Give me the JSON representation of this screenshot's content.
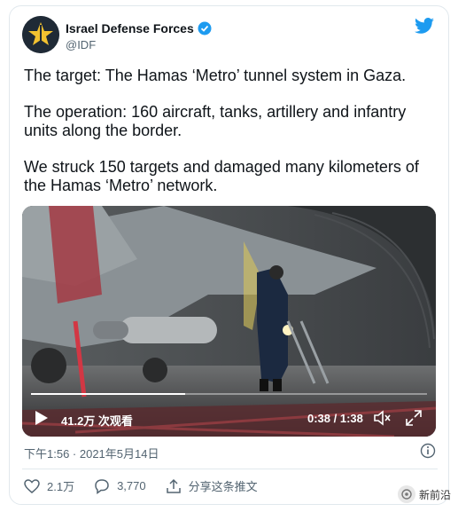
{
  "author": {
    "name": "Israel Defense Forces",
    "handle": "@IDF"
  },
  "tweet": {
    "paragraphs": [
      "The target: The Hamas ‘Metro’ tunnel system in Gaza.",
      "The operation: 160 aircraft, tanks, artillery and infantry units along the border.",
      "We struck 150 targets and damaged many kilometers of the Hamas ‘Metro’ network."
    ]
  },
  "video": {
    "views": "41.2万 次观看",
    "time": "0:38 / 1:38",
    "progress": 0.39
  },
  "meta": {
    "timestamp": "下午1:56 · 2021年5月14日"
  },
  "actions": {
    "likes": "2.1万",
    "replies": "3,770",
    "share": "分享这条推文"
  },
  "watermark": "新前沿",
  "colors": {
    "accent": "#1d9bf0",
    "text": "#0f1419",
    "muted": "#536471"
  },
  "icons": [
    "idf-logo-icon",
    "verified-badge-icon",
    "twitter-bird-icon",
    "play-icon",
    "volume-icon",
    "fullscreen-icon",
    "info-icon",
    "heart-icon",
    "reply-icon",
    "share-icon",
    "watermark-icon"
  ]
}
